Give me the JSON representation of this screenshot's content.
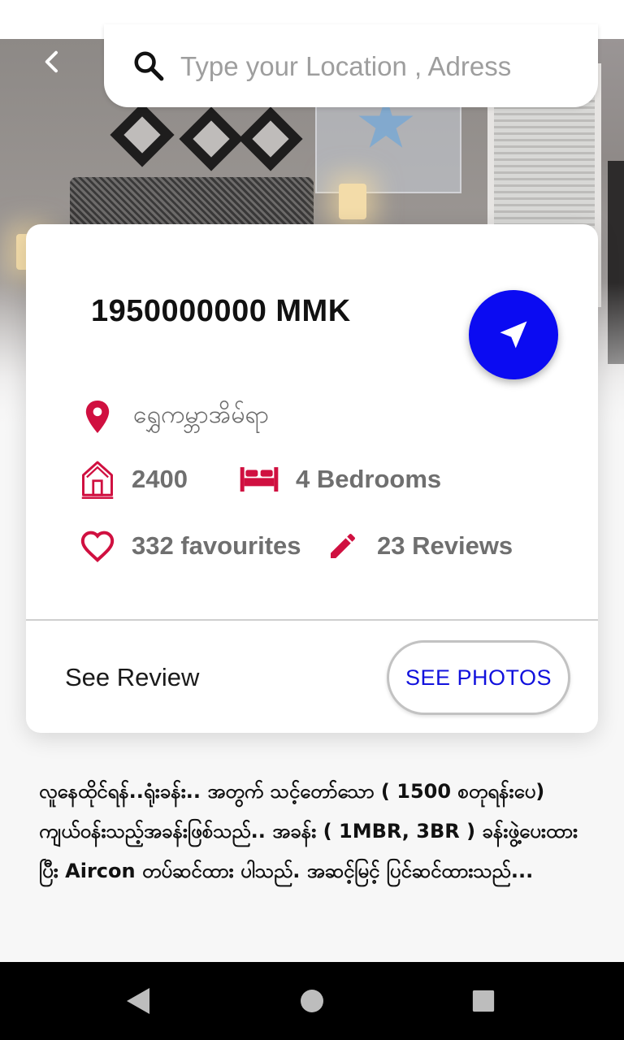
{
  "search": {
    "placeholder": "Type your Location , Adress"
  },
  "listing": {
    "price": "1950000000 MMK",
    "location": "ရွှေကမ္ဘာအိမ်ရာ",
    "area": "2400",
    "bedrooms": "4 Bedrooms",
    "favourites": "332 favourites",
    "reviews": "23 Reviews",
    "description": "လူနေထိုင်ရန်..ရုံးခန်း.. အတွက် သင့်တော်သော ( 1500 စတုရန်းပေ) ကျယ်ဝန်းသည့်အခန်းဖြစ်သည်.. အခန်း ( 1MBR, 3BR ) ခန်းဖွဲ့ပေးထားပြီး Aircon တပ်ဆင်ထား ပါသည်. အဆင့်မြင့် ပြင်ဆင်ထားသည်..."
  },
  "actions": {
    "see_review": "See Review",
    "see_photos": "SEE PHOTOS"
  },
  "colors": {
    "accent_red": "#d01040",
    "fab_blue": "#0b0bf2",
    "link_blue": "#1111dd"
  },
  "icons": {
    "back": "chevron-left-icon",
    "search": "search-icon",
    "navigate": "navigation-arrow-icon",
    "location": "map-pin-icon",
    "area": "house-icon",
    "bedrooms": "bed-icon",
    "favourites": "heart-icon",
    "reviews": "pencil-icon"
  }
}
